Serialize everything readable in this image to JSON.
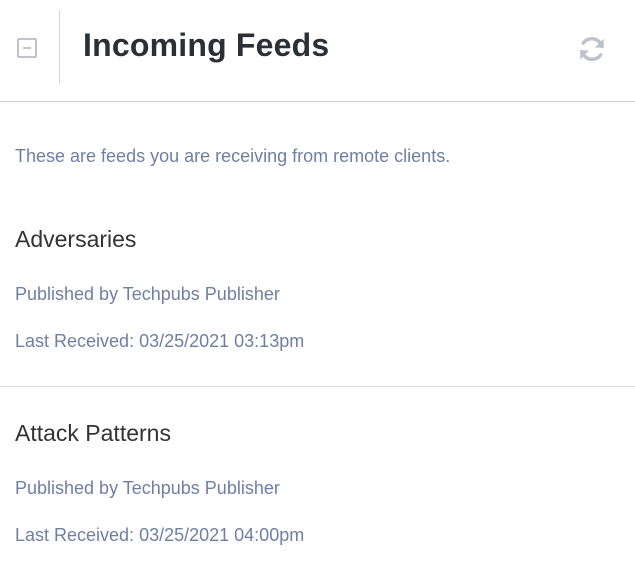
{
  "header": {
    "title": "Incoming Feeds",
    "collapse_icon": "minus-square-icon",
    "refresh_icon": "refresh-icon"
  },
  "intro": "These are feeds you are receiving from remote clients.",
  "feeds": [
    {
      "name": "Adversaries",
      "publisher": "Published by Techpubs Publisher",
      "last_received": "Last Received: 03/25/2021 03:13pm"
    },
    {
      "name": "Attack Patterns",
      "publisher": "Published by Techpubs Publisher",
      "last_received": "Last Received: 03/25/2021 04:00pm"
    }
  ],
  "colors": {
    "title": "#2b2f36",
    "link": "#6f7fa3",
    "icon": "#bfc2cc",
    "divider": "#c9ccd9"
  }
}
